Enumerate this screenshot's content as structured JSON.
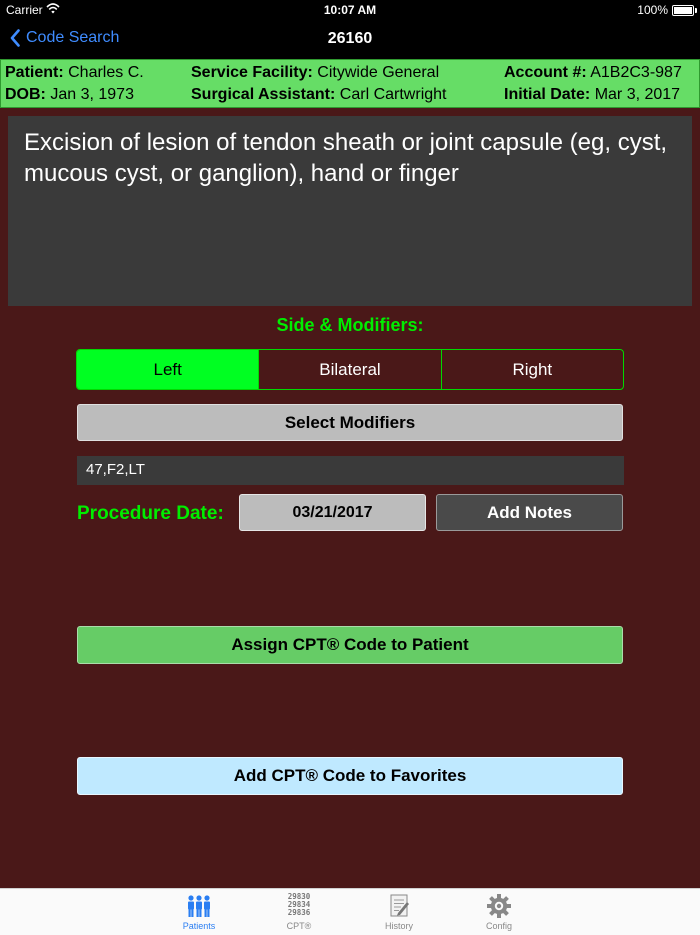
{
  "status_bar": {
    "carrier": "Carrier",
    "time": "10:07 AM",
    "battery": "100%"
  },
  "nav": {
    "back_label": "Code Search",
    "title": "26160"
  },
  "patient_info": {
    "patient_label": "Patient:",
    "patient": "Charles C.",
    "dob_label": "DOB:",
    "dob": "Jan 3, 1973",
    "facility_label": "Service Facility:",
    "facility": "Citywide General",
    "assistant_label": "Surgical Assistant:",
    "assistant": "Carl Cartwright",
    "account_label": "Account #:",
    "account": "A1B2C3-987",
    "initial_date_label": "Initial Date:",
    "initial_date": "Mar 3, 2017"
  },
  "description": "Excision of lesion of tendon sheath or joint capsule (eg, cyst, mucous cyst, or ganglion), hand or finger",
  "side_modifiers": {
    "label": "Side & Modifiers:",
    "options": [
      "Left",
      "Bilateral",
      "Right"
    ],
    "selected": "Left",
    "select_modifiers_label": "Select Modifiers",
    "modifiers_value": "47,F2,LT"
  },
  "procedure": {
    "date_label": "Procedure Date:",
    "date": "03/21/2017",
    "add_notes_label": "Add Notes"
  },
  "actions": {
    "assign_label": "Assign CPT® Code to Patient",
    "favorites_label": "Add CPT® Code to Favorites"
  },
  "tabs": [
    {
      "label": "Patients",
      "icon": "patients-icon",
      "active": true
    },
    {
      "label": "CPT®",
      "icon": "cpt-codes-icon",
      "icon_text": [
        "29830",
        "29834",
        "29836"
      ],
      "active": false
    },
    {
      "label": "History",
      "icon": "history-icon",
      "active": false
    },
    {
      "label": "Config",
      "icon": "gear-icon",
      "active": false
    }
  ],
  "colors": {
    "background": "#4a1818",
    "info_bar": "#66dd66",
    "accent_green": "#00ff22",
    "link_blue": "#3f8cff",
    "favorites": "#bfe9ff"
  }
}
